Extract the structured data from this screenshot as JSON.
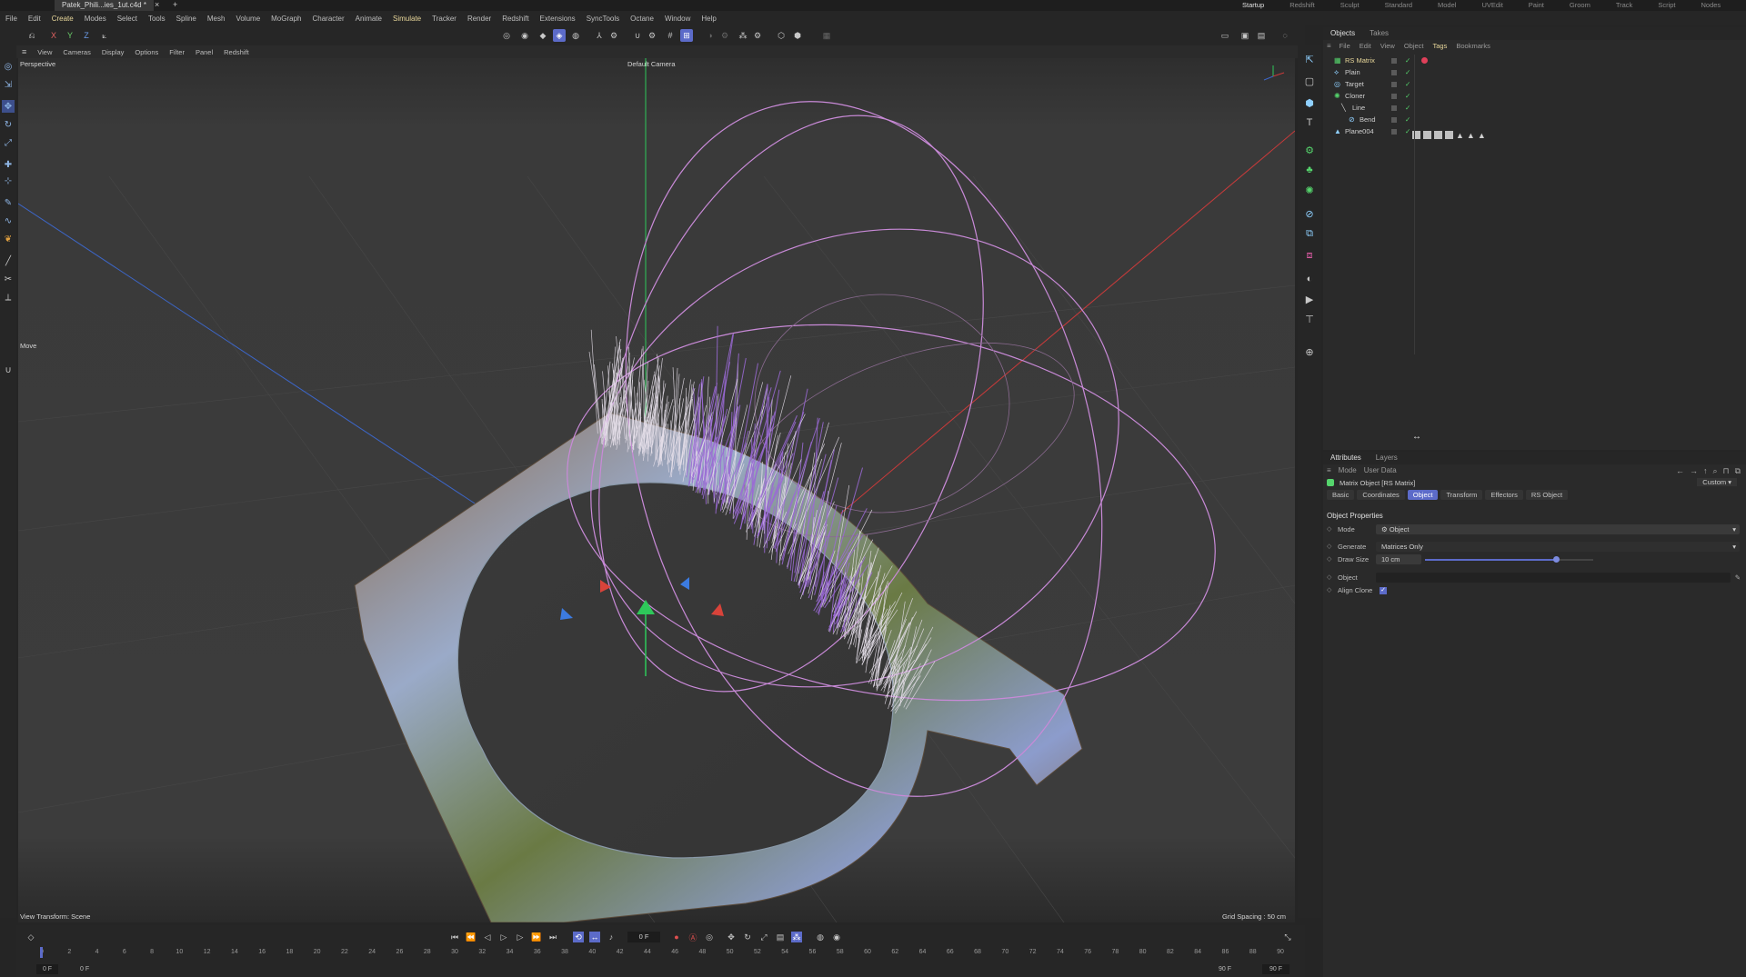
{
  "window": {
    "file_tab": "Patek_Phili...ies_1ut.c4d *",
    "layout_tabs": [
      "Startup",
      "Redshift",
      "Sculpt",
      "Standard",
      "Model",
      "UVEdit",
      "Paint",
      "Groom",
      "Track",
      "Script",
      "Nodes"
    ],
    "active_layout": "Startup"
  },
  "menubar": [
    "File",
    "Edit",
    "Create",
    "Modes",
    "Select",
    "Tools",
    "Spline",
    "Mesh",
    "Volume",
    "MoGraph",
    "Character",
    "Animate",
    "Simulate",
    "Tracker",
    "Render",
    "Redshift",
    "Extensions",
    "SyncTools",
    "Octane",
    "Window",
    "Help"
  ],
  "toolbar": {
    "axis_labels": [
      "X",
      "Y",
      "Z"
    ]
  },
  "viewport": {
    "menu": [
      "View",
      "Cameras",
      "Display",
      "Options",
      "Filter",
      "Panel",
      "Redshift"
    ],
    "name": "Perspective",
    "camera": "Default Camera",
    "move_label": "Move",
    "view_transform": "View Transform: Scene",
    "grid_spacing": "Grid Spacing : 50 cm"
  },
  "objects_panel": {
    "tabs": [
      "Objects",
      "Takes"
    ],
    "menu": [
      "File",
      "Edit",
      "View",
      "Object",
      "Tags",
      "Bookmarks"
    ],
    "items": [
      {
        "name": "RS Matrix",
        "indent": 0,
        "icon": "matrix-icon",
        "highlight": true
      },
      {
        "name": "Plain",
        "indent": 0,
        "icon": "plain-effector-icon"
      },
      {
        "name": "Target",
        "indent": 0,
        "icon": "target-icon"
      },
      {
        "name": "Cloner",
        "indent": 0,
        "icon": "cloner-icon"
      },
      {
        "name": "Line",
        "indent": 1,
        "icon": "spline-icon"
      },
      {
        "name": "Bend",
        "indent": 2,
        "icon": "bend-deformer-icon"
      },
      {
        "name": "Plane004",
        "indent": 0,
        "icon": "plane-icon"
      }
    ]
  },
  "attributes_panel": {
    "tabs": [
      "Attributes",
      "Layers"
    ],
    "menu": [
      "Mode",
      "User Data"
    ],
    "object_title": "Matrix Object [RS Matrix]",
    "preset": "Custom",
    "subtabs": [
      "Basic",
      "Coordinates",
      "Object",
      "Transform",
      "Effectors",
      "RS Object"
    ],
    "active_subtab": "Object",
    "section": "Object Properties",
    "properties": {
      "mode_label": "Mode",
      "mode_value": "Object",
      "generate_label": "Generate",
      "generate_value": "Matrices Only",
      "draw_size_label": "Draw Size",
      "draw_size_value": "10 cm",
      "draw_size_fraction": 0.78,
      "object_label": "Object",
      "object_value": "",
      "align_clone_label": "Align Clone",
      "align_clone_checked": true
    }
  },
  "timeline": {
    "current_frame": "0 F",
    "start_frame": "0 F",
    "start_frame_2": "0 F",
    "end_frame": "90 F",
    "end_frame_2": "90 F",
    "ticks": [
      "0",
      "2",
      "4",
      "6",
      "8",
      "10",
      "12",
      "14",
      "16",
      "18",
      "20",
      "22",
      "24",
      "26",
      "28",
      "30",
      "32",
      "34",
      "36",
      "38",
      "40",
      "42",
      "44",
      "46",
      "48",
      "50",
      "52",
      "54",
      "56",
      "58",
      "60",
      "62",
      "64",
      "66",
      "68",
      "70",
      "72",
      "74",
      "76",
      "78",
      "80",
      "82",
      "84",
      "86",
      "88",
      "90"
    ]
  },
  "colors": {
    "accent": "#5c6bc9",
    "x_axis": "#d8433a",
    "y_axis": "#35d15a",
    "z_axis": "#3c7be0",
    "spline": "#c98ad8",
    "hair": "#9b6ad6"
  }
}
